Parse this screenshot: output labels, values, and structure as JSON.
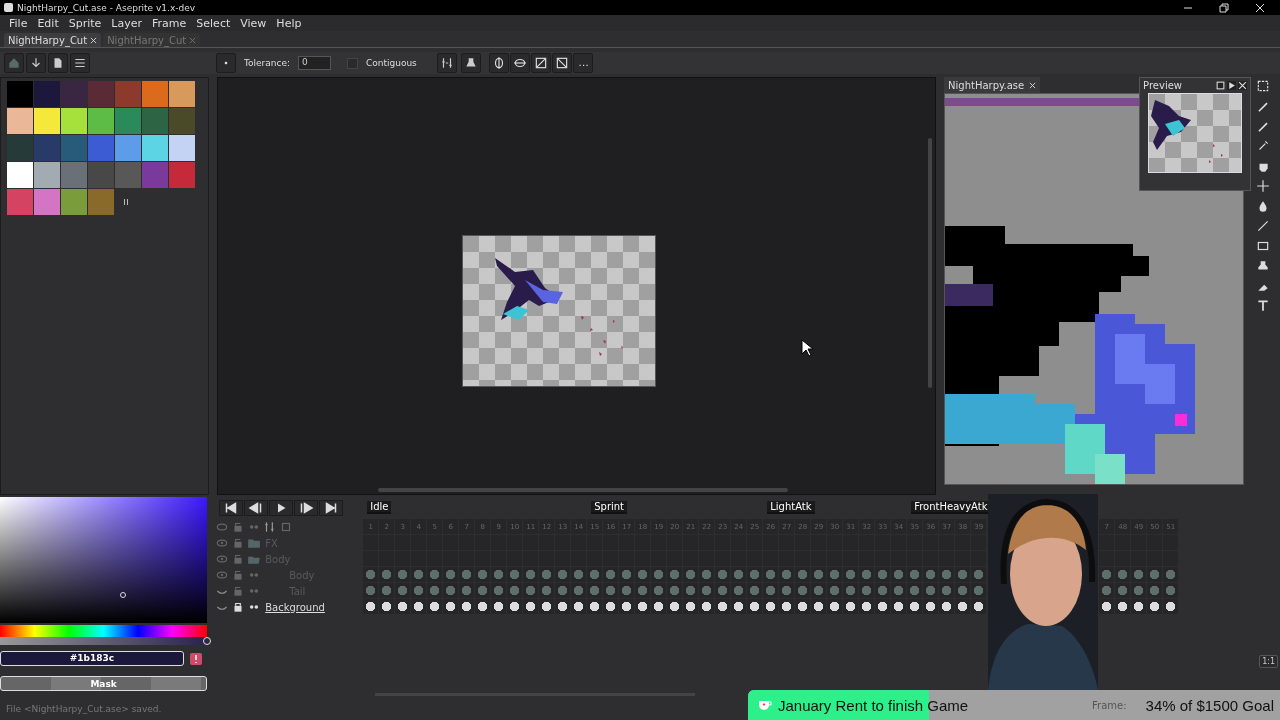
{
  "window": {
    "title": "NightHarpy_Cut.ase - Aseprite v1.x-dev"
  },
  "menu": [
    "File",
    "Edit",
    "Sprite",
    "Layer",
    "Frame",
    "Select",
    "View",
    "Help"
  ],
  "tabs": [
    {
      "label": "NightHarpy_Cut",
      "selected": true
    },
    {
      "label": "NightHarpy_Cut",
      "selected": false
    }
  ],
  "toolbar": {
    "tolerance_label": "Tolerance:",
    "tolerance": "0",
    "contiguous_label": "Contiguous",
    "contiguous": false
  },
  "palette": [
    {
      "color": "#000000"
    },
    {
      "color": "#1b183c"
    },
    {
      "color": "#3a2642"
    },
    {
      "color": "#5a2a36"
    },
    {
      "color": "#8c3a2c"
    },
    {
      "color": "#dc6a1c"
    },
    {
      "color": "#d89a5c"
    },
    {
      "color": "#eab898"
    },
    {
      "color": "#f4e83a"
    },
    {
      "color": "#a6e03a"
    },
    {
      "color": "#5cbc46"
    },
    {
      "color": "#2a8a5c"
    },
    {
      "color": "#2c6444"
    },
    {
      "color": "#4a4a28"
    },
    {
      "color": "#263a3a"
    },
    {
      "color": "#283a68"
    },
    {
      "color": "#285a7a"
    },
    {
      "color": "#3c5cd4"
    },
    {
      "color": "#5c9ce8"
    },
    {
      "color": "#5cd4e4"
    },
    {
      "color": "#c4d2f4"
    },
    {
      "color": "#ffffff"
    },
    {
      "color": "#a2aab2"
    },
    {
      "color": "#6a7078"
    },
    {
      "color": "#484848"
    },
    {
      "color": "#585858"
    },
    {
      "color": "#7a3a9c"
    },
    {
      "color": "#c42a3a"
    },
    {
      "color": "#d44462"
    },
    {
      "color": "#d474c4"
    },
    {
      "color": "#7a9c3a"
    },
    {
      "color": "#8a6a2a"
    }
  ],
  "color_picker": {
    "hex": "#1b183c",
    "alpha": {
      "level": 1
    }
  },
  "mask_button": "Mask",
  "side_editor": {
    "tab": "NightHarpy.ase"
  },
  "preview": {
    "title": "Preview"
  },
  "timeline": {
    "frames": [
      {
        "n": "1",
        "tag": "Idle"
      },
      {
        "n": "2"
      },
      {
        "n": "3"
      },
      {
        "n": "4"
      },
      {
        "n": "5"
      },
      {
        "n": "6"
      },
      {
        "n": "7"
      },
      {
        "n": "8"
      },
      {
        "n": "9"
      },
      {
        "n": "10"
      },
      {
        "n": "11"
      },
      {
        "n": "12"
      },
      {
        "n": "13"
      },
      {
        "n": "14"
      },
      {
        "n": "15",
        "tag": "Sprint"
      },
      {
        "n": "16"
      },
      {
        "n": "17"
      },
      {
        "n": "18"
      },
      {
        "n": "19"
      },
      {
        "n": "20"
      },
      {
        "n": "21"
      },
      {
        "n": "22"
      },
      {
        "n": "23"
      },
      {
        "n": "24"
      },
      {
        "n": "25"
      },
      {
        "n": "26",
        "tag": "LightAtk"
      },
      {
        "n": "27"
      },
      {
        "n": "28"
      },
      {
        "n": "29"
      },
      {
        "n": "30"
      },
      {
        "n": "31"
      },
      {
        "n": "32"
      },
      {
        "n": "33"
      },
      {
        "n": "34"
      },
      {
        "n": "35",
        "tag": "FrontHeavyAtk"
      },
      {
        "n": "36"
      },
      {
        "n": "37"
      },
      {
        "n": "38"
      },
      {
        "n": "39"
      }
    ],
    "frames_right": [
      {
        "n": "7"
      },
      {
        "n": "48"
      },
      {
        "n": "49"
      },
      {
        "n": "50"
      },
      {
        "n": "51"
      }
    ],
    "layers": [
      {
        "name": "FX",
        "kind": "group",
        "expanded": false,
        "visible": true,
        "locked": false,
        "selected": false
      },
      {
        "name": "Body",
        "kind": "group",
        "expanded": true,
        "visible": true,
        "locked": false,
        "selected": false,
        "children": [
          {
            "name": "Body",
            "kind": "layer",
            "visible": true,
            "locked": false,
            "selected": false
          },
          {
            "name": "Tail",
            "kind": "layer",
            "visible": false,
            "locked": false,
            "selected": false
          }
        ]
      },
      {
        "name": "Background",
        "kind": "layer",
        "visible": false,
        "locked": true,
        "selected": true
      }
    ]
  },
  "status": "File <NightHarpy_Cut.ase> saved.",
  "frame_label": "Frame:",
  "zoom_button": "1:1",
  "goal": {
    "title": "January Rent to finish Game",
    "progress": "34% of $1500 Goal",
    "level": 0.34
  }
}
